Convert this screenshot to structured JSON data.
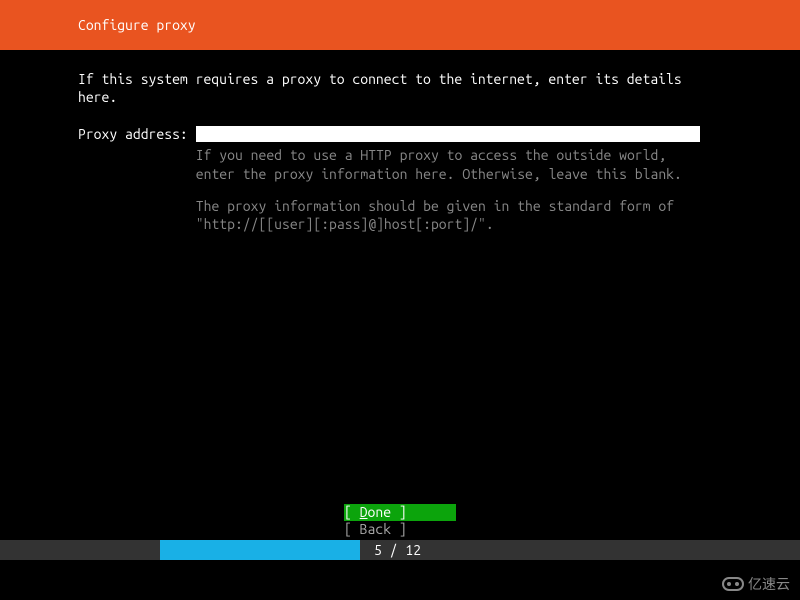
{
  "header": {
    "title": "Configure proxy"
  },
  "intro": "If this system requires a proxy to connect to the internet, enter its details here.",
  "field": {
    "label": "Proxy address:",
    "value": "",
    "help1": "If you need to use a HTTP proxy to access the outside world, enter the proxy information here. Otherwise, leave this blank.",
    "help2": "The proxy information should be given in the standard form of \"http://[[user][:pass]@]host[:port]/\"."
  },
  "buttons": {
    "done_prefix": "[ ",
    "done_key": "D",
    "done_rest": "one",
    "done_suffix": "      ]",
    "back": "[ Back      ]"
  },
  "progress": {
    "current": 5,
    "total": 12,
    "text": "5 / 12"
  },
  "watermark": "亿速云"
}
